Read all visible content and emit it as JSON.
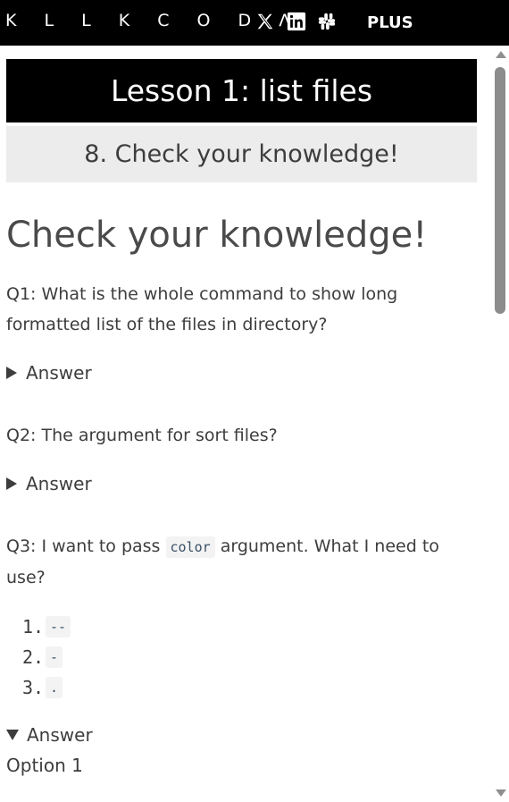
{
  "header": {
    "logo": "KILLERCODA",
    "logo_display": "K L L K C O D Λ",
    "social": [
      {
        "name": "x-icon",
        "glyph": "𝕏"
      },
      {
        "name": "linkedin-icon",
        "glyph": "in"
      },
      {
        "name": "slack-icon",
        "glyph": "✢"
      }
    ],
    "plus_label": "PLUS"
  },
  "lesson": {
    "title": "Lesson 1: list files",
    "step": "8. Check your knowledge!"
  },
  "content": {
    "heading": "Check your knowledge!",
    "q1": "Q1: What is the whole command to show long formatted list of the files in directory?",
    "q1_answer_label": "Answer",
    "q2": "Q2: The argument for sort files?",
    "q2_answer_label": "Answer",
    "q3_before": "Q3: I want to pass ",
    "q3_code": "color",
    "q3_after": " argument. What I need to use?",
    "options": [
      {
        "num": "1.",
        "code": "--"
      },
      {
        "num": "2.",
        "code": "-"
      },
      {
        "num": "3.",
        "code": "."
      }
    ],
    "q3_answer_label": "Answer",
    "q3_answer_text": "Option 1"
  },
  "colors": {
    "topbar": "#000000",
    "lesson_banner": "#000000",
    "step_banner": "#ececec",
    "text": "#3d3d3d",
    "code_bg": "#f3f3f3"
  }
}
